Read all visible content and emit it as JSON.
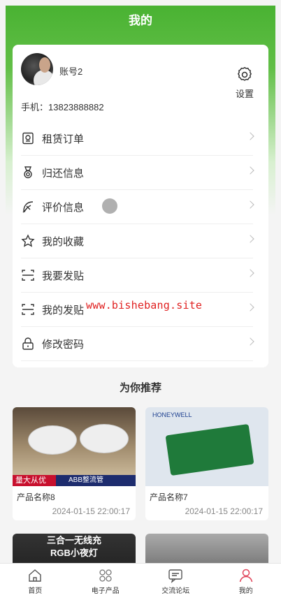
{
  "header": {
    "title": "我的"
  },
  "profile": {
    "username": "账号2",
    "settings_label": "设置",
    "phone_label": "手机：",
    "phone": "13823888882"
  },
  "menu": [
    {
      "label": "租赁订单",
      "icon": "order-icon"
    },
    {
      "label": "归还信息",
      "icon": "medal-icon"
    },
    {
      "label": "评价信息",
      "icon": "feather-icon"
    },
    {
      "label": "我的收藏",
      "icon": "star-icon"
    },
    {
      "label": "我要发贴",
      "icon": "scan-icon"
    },
    {
      "label": "我的发贴",
      "icon": "scan-icon"
    },
    {
      "label": "修改密码",
      "icon": "lock-icon"
    }
  ],
  "watermark": "www.bishebang.site",
  "recommend": {
    "title": "为你推荐",
    "products": [
      {
        "name": "产品名称8",
        "date": "2024-01-15 22:00:17",
        "badge": "量大从优",
        "banner": "ABB整流管"
      },
      {
        "name": "产品名称7",
        "date": "2024-01-15 22:00:17",
        "brand": "HONEYWELL"
      },
      {
        "banner_line1": "三合一无线充",
        "banner_line2": "RGB小夜灯"
      },
      {}
    ]
  },
  "tabbar": [
    {
      "label": "首页",
      "icon": "home-icon"
    },
    {
      "label": "电子产品",
      "icon": "grid-icon"
    },
    {
      "label": "交流论坛",
      "icon": "chat-icon"
    },
    {
      "label": "我的",
      "icon": "person-icon",
      "active": true
    }
  ],
  "colors": {
    "accent": "#49b232",
    "active_tab": "#e0455a"
  }
}
